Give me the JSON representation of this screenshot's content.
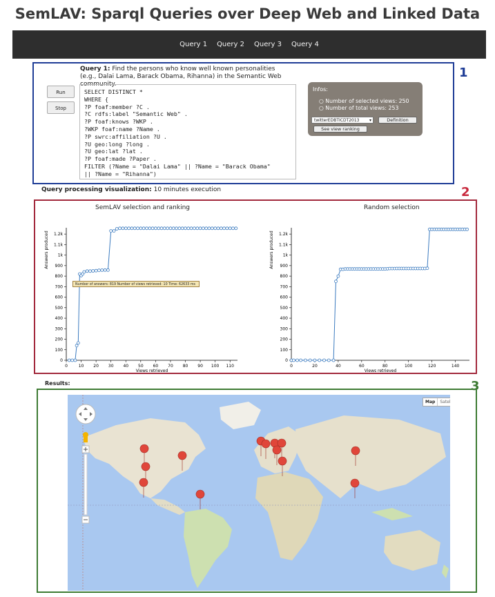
{
  "page_title": "SemLAV: Sparql Queries over Deep Web and Linked Data",
  "nav": {
    "items": [
      "Query 1",
      "Query 2",
      "Query 3",
      "Query 4"
    ]
  },
  "sections": {
    "n1": "1",
    "n2": "2",
    "n3": "3"
  },
  "query": {
    "label": "Query 1:",
    "description": "Find the persons who know well known personalities (e.g., Dalai Lama, Barack Obama, Rihanna) in the Semantic Web community.",
    "run_label": "Run",
    "stop_label": "Stop",
    "text": "SELECT DISTINCT *\nWHERE {\n?P foaf:member ?C .\n?C rdfs:label \"Semantic Web\" .\n?P foaf:knows ?WKP .\n?WKP foaf:name ?Name .\n?P swrc:affiliation ?U .\n?U geo:long ?long .\n?U geo:lat ?lat .\n?P foaf:made ?Paper .\nFILTER (?Name = \"Dalai Lama\" || ?Name = \"Barack Obama\"\n|| ?Name = \"Rihanna\")\n}"
  },
  "infos": {
    "title": "Infos:",
    "selected_views": "Number of selected views: 250",
    "total_views": "Number of total views: 253",
    "view_select": "twitterEDBTICDT2013",
    "definition_label": "Definition",
    "ranking_label": "See view ranking"
  },
  "visualization": {
    "label": "Query processing visualization:",
    "text": "10 minutes execution"
  },
  "tooltip": "Number of answers: 819 Number of views retrieved: 10 Time: 62633 ms",
  "results_label": "Results:",
  "map": {
    "map_label": "Map",
    "satellite_label": "Satellite"
  },
  "chart_data": [
    {
      "type": "line",
      "title": "SemLAV selection and ranking",
      "xlabel": "Views retrieved",
      "ylabel": "Answers produced",
      "xlim": [
        0,
        115
      ],
      "ylim": [
        0,
        1260
      ],
      "xticks": [
        0,
        10,
        20,
        30,
        40,
        50,
        60,
        70,
        80,
        90,
        100,
        110
      ],
      "yticks": [
        0,
        100,
        200,
        300,
        400,
        500,
        600,
        700,
        800,
        900,
        1000,
        1100,
        1200
      ],
      "ytick_labels": [
        "0",
        "100",
        "200",
        "300",
        "400",
        "500",
        "600",
        "700",
        "800",
        "900",
        "1k",
        "1.1k",
        "1.2k"
      ],
      "color": "#3a7abf",
      "x": [
        2,
        4,
        6,
        7,
        8,
        9,
        10,
        11,
        12,
        14,
        16,
        18,
        20,
        22,
        24,
        26,
        28,
        30,
        32,
        34,
        36,
        38,
        40,
        42,
        44,
        46,
        48,
        50,
        52,
        54,
        56,
        58,
        60,
        62,
        64,
        66,
        68,
        70,
        72,
        74,
        76,
        78,
        80,
        82,
        84,
        86,
        88,
        90,
        92,
        94,
        96,
        98,
        100,
        102,
        104,
        106,
        108,
        110,
        112,
        114
      ],
      "y": [
        0,
        0,
        0,
        140,
        165,
        820,
        805,
        820,
        840,
        848,
        848,
        850,
        852,
        855,
        857,
        858,
        858,
        1230,
        1230,
        1250,
        1255,
        1255,
        1255,
        1255,
        1255,
        1255,
        1255,
        1255,
        1255,
        1255,
        1255,
        1255,
        1255,
        1255,
        1255,
        1255,
        1255,
        1255,
        1255,
        1255,
        1255,
        1255,
        1255,
        1255,
        1255,
        1255,
        1255,
        1255,
        1255,
        1255,
        1255,
        1255,
        1255,
        1255,
        1255,
        1255,
        1255,
        1255,
        1255,
        1255
      ]
    },
    {
      "type": "line",
      "title": "Random selection",
      "xlabel": "Views retrieved",
      "ylabel": "Answers produced",
      "xlim": [
        0,
        152
      ],
      "ylim": [
        0,
        1260
      ],
      "xticks": [
        0,
        20,
        40,
        60,
        80,
        100,
        120,
        140
      ],
      "yticks": [
        0,
        100,
        200,
        300,
        400,
        500,
        600,
        700,
        800,
        900,
        1000,
        1100,
        1200
      ],
      "ytick_labels": [
        "0",
        "100",
        "200",
        "300",
        "400",
        "500",
        "600",
        "700",
        "800",
        "900",
        "1k",
        "1.1k",
        "1.2k"
      ],
      "color": "#3a7abf",
      "x": [
        0,
        2,
        5,
        8,
        12,
        16,
        20,
        24,
        28,
        32,
        36,
        38,
        40,
        42,
        44,
        46,
        48,
        50,
        52,
        54,
        56,
        58,
        60,
        62,
        64,
        66,
        68,
        70,
        72,
        74,
        76,
        78,
        80,
        82,
        84,
        86,
        88,
        90,
        92,
        94,
        96,
        98,
        100,
        102,
        104,
        106,
        108,
        110,
        112,
        114,
        116,
        118,
        120,
        122,
        124,
        126,
        128,
        130,
        132,
        134,
        136,
        138,
        140,
        142,
        144,
        146,
        148,
        150
      ],
      "y": [
        0,
        0,
        0,
        0,
        0,
        0,
        0,
        0,
        0,
        0,
        0,
        750,
        800,
        865,
        865,
        868,
        868,
        868,
        868,
        868,
        868,
        868,
        868,
        868,
        868,
        868,
        868,
        868,
        868,
        868,
        868,
        868,
        868,
        870,
        872,
        872,
        872,
        873,
        873,
        873,
        873,
        873,
        873,
        873,
        873,
        873,
        873,
        873,
        873,
        873,
        875,
        1245,
        1245,
        1245,
        1245,
        1245,
        1245,
        1245,
        1245,
        1245,
        1245,
        1245,
        1245,
        1245,
        1245,
        1245,
        1245,
        1245
      ]
    }
  ]
}
